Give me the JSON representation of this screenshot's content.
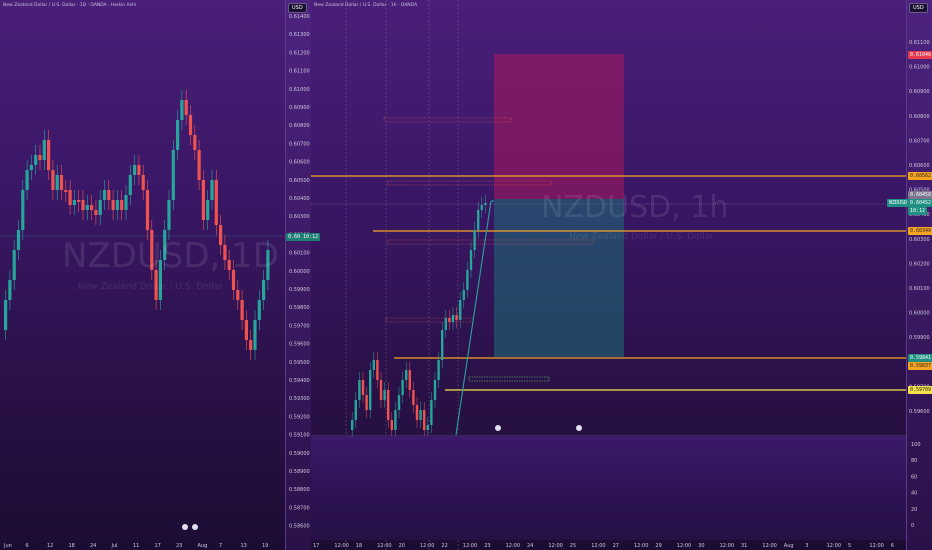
{
  "left_chart": {
    "symbol_title": "New Zealand Dollar / U.S. Dollar · 1D · OANDA · Heikin Ashi",
    "watermark_symbol": "NZDUSD, 1D",
    "watermark_desc": "New Zealand Dollar / U.S. Dollar",
    "currency_button": "USD",
    "price_ticks": [
      "0.61400",
      "0.61300",
      "0.61200",
      "0.61100",
      "0.61000",
      "0.60900",
      "0.60800",
      "0.60700",
      "0.60600",
      "0.60500",
      "0.60400",
      "0.60300",
      "0.60200",
      "0.60100",
      "0.60000",
      "0.59900",
      "0.59800",
      "0.59700",
      "0.59600",
      "0.59500",
      "0.59400",
      "0.59300",
      "0.59200",
      "0.59100",
      "0.59000",
      "0.58900",
      "0.58800",
      "0.58700",
      "0.58600"
    ],
    "last_price_tag": "0.60 10:12",
    "time_ticks": [
      "Jun",
      "6",
      "12",
      "18",
      "24",
      "Jul",
      "11",
      "17",
      "23",
      "Aug",
      "7",
      "13",
      "19"
    ]
  },
  "right_chart": {
    "symbol_title": "New Zealand Dollar / U.S. Dollar · 1h · OANDA",
    "watermark_symbol": "NZDUSD, 1h",
    "watermark_desc": "New Zealand Dollar / U.S. Dollar",
    "currency_button": "USD",
    "price_ticks": [
      "0.61100",
      "0.61000",
      "0.60900",
      "0.60800",
      "0.60700",
      "0.60600",
      "0.60500",
      "0.60400",
      "0.60300",
      "0.60200",
      "0.60100",
      "0.60000",
      "0.59900",
      "0.59800",
      "0.59700",
      "0.59600"
    ],
    "tags": {
      "stop_loss": "0.61046",
      "resistance": "0.60562",
      "current_price_label": "0.60458",
      "symbol_label": "NZDUSD",
      "current_price": "0.60452",
      "countdown": "10:12",
      "level_mid": "0.60349",
      "entry_teal": "0.59841",
      "entry_orange": "0.59837",
      "support_yellow": "0.59709"
    },
    "indicator_ticks": [
      "100",
      "80",
      "60",
      "40",
      "20",
      "0"
    ],
    "time_ticks": [
      "17",
      "12:00",
      "18",
      "12:00",
      "20",
      "12:00",
      "22",
      "12:00",
      "23",
      "12:00",
      "24",
      "12:00",
      "25",
      "12:00",
      "27",
      "12:00",
      "29",
      "12:00",
      "30",
      "12:00",
      "31",
      "12:00",
      "Aug",
      "3",
      "12:00",
      "5",
      "12:00",
      "6"
    ]
  },
  "colors": {
    "bull": "#26a69a",
    "bear": "#ef5350",
    "orange_line": "#f7a520",
    "yellow_line": "#f5e14a",
    "stop_zone": "#c2185b",
    "target_zone": "#1e6f78"
  }
}
